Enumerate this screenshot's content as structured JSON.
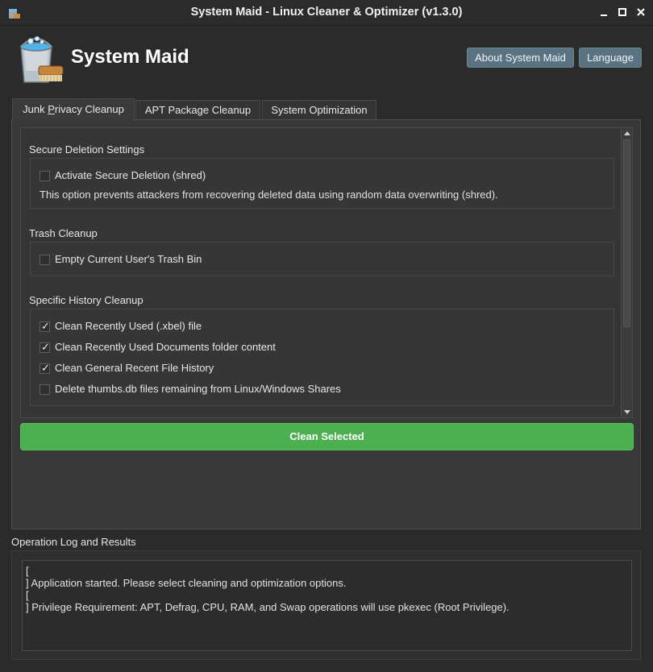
{
  "window": {
    "title": "System Maid - Linux Cleaner & Optimizer (v1.3.0)",
    "icon": "app-bucket-icon"
  },
  "header": {
    "app_name": "System Maid",
    "about_label": "About System Maid",
    "language_label": "Language"
  },
  "tabs": [
    {
      "label": "Junk Privacy Cleanup",
      "mnemonic_prefix": "Junk ",
      "mnemonic_char": "P",
      "mnemonic_rest": "rivacy Cleanup",
      "active": true
    },
    {
      "label": "APT Package Cleanup",
      "active": false
    },
    {
      "label": "System Optimization",
      "active": false
    }
  ],
  "secure_deletion": {
    "title": "Secure Deletion Settings",
    "checkbox_label": "Activate Secure Deletion (shred)",
    "checked": false,
    "description": "This option prevents attackers from recovering deleted data using random data overwriting (shred)."
  },
  "trash": {
    "title": "Trash Cleanup",
    "checkbox_label": "Empty Current User's Trash Bin",
    "checked": false
  },
  "history": {
    "title": "Specific History Cleanup",
    "items": [
      {
        "label": "Clean Recently Used (.xbel) file",
        "checked": true
      },
      {
        "label": "Clean Recently Used Documents folder content",
        "checked": true
      },
      {
        "label": "Clean General Recent File History",
        "checked": true
      },
      {
        "label": "Delete thumbs.db files remaining from Linux/Windows Shares",
        "checked": false
      }
    ]
  },
  "actions": {
    "clean_label": "Clean Selected",
    "clean_color": "#4caf50"
  },
  "log": {
    "title": "Operation Log and Results",
    "lines": [
      "[",
      "] Application started. Please select cleaning and optimization options.",
      "[",
      "] Privilege Requirement: APT, Defrag, CPU, RAM, and Swap operations will use pkexec (Root Privilege)."
    ]
  },
  "colors": {
    "background": "#2b2b2b",
    "header_button": "#5a7382",
    "accent_green": "#4caf50"
  }
}
